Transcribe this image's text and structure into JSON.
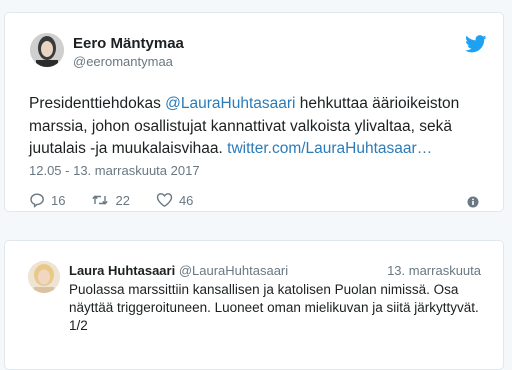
{
  "tweet1": {
    "author_name": "Eero Mäntymaa",
    "author_handle": "@eeromantymaa",
    "text_before": "Presidenttiehdokas ",
    "mention": "@LauraHuhtasaari",
    "text_after": " hehkuttaa äärioikeiston marssia, johon osallistujat kannattivat valkoista ylivaltaa, sekä juutalais -ja muukalaisvihaa. ",
    "link": "twitter.com/LauraHuhtasaar…",
    "date": "12.05 - 13. marraskuuta 2017",
    "replies": "16",
    "retweets": "22",
    "likes": "46",
    "icons": [
      "twitter-bird-icon",
      "reply-icon",
      "retweet-icon",
      "like-heart-icon",
      "info-icon"
    ]
  },
  "tweet2": {
    "author_name": "Laura Huhtasaari",
    "author_handle": "@LauraHuhtasaari",
    "time": "13. marraskuuta",
    "text": "Puolassa marssittiin kansallisen ja katolisen Puolan nimissä. Osa näyttää triggeroituneen. Luoneet oman mielikuvan ja siitä järkyttyvät. 1/2"
  },
  "colors": {
    "link": "#2b7bb9",
    "bird": "#1da1f2",
    "muted": "#697882"
  }
}
